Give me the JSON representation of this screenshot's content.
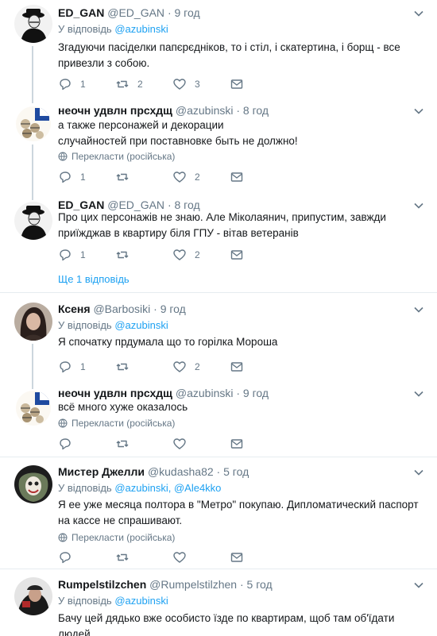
{
  "reply_label": "У відповідь",
  "translate_label": "Перекласти (російська)",
  "more_replies": "Ще 1 відповідь",
  "tweets": [
    {
      "name": "ED_GAN",
      "handle": "@ED_GAN",
      "dot": "·",
      "time": "9 год",
      "reply_to": "@azubinski",
      "text": "Згадуючи пасіделки папєрєдніков, то і стіл, і скатертина, і борщ - все привезли з собою.",
      "replies": "1",
      "retweets": "2",
      "likes": "3"
    },
    {
      "name": "неочн удвлн прсхдщ",
      "handle": "@azubinski",
      "dot": "·",
      "time": "8 год",
      "text": "а также персонажей и декорации\nслучайностей при поставновке быть не должно!",
      "replies": "1",
      "retweets": "",
      "likes": "2"
    },
    {
      "name": "ED_GAN",
      "handle": "@ED_GAN",
      "dot": "·",
      "time": "8 год",
      "text": "Про цих персонажів не знаю. Але Міколаянич, припустим, завжди приїжджав в квартиру біля ГПУ - вітав ветеранів",
      "replies": "1",
      "retweets": "",
      "likes": "2"
    },
    {
      "name": "Ксеня",
      "handle": "@Barbosiki",
      "dot": "·",
      "time": "9 год",
      "reply_to": "@azubinski",
      "text": "Я спочатку прдумала що то горілка Мороша",
      "replies": "1",
      "retweets": "",
      "likes": "2"
    },
    {
      "name": "неочн удвлн прсхдщ",
      "handle": "@azubinski",
      "dot": "·",
      "time": "9 год",
      "text": "всё много хуже оказалось"
    },
    {
      "name": "Мистер Джелли",
      "handle": "@kudasha82",
      "dot": "·",
      "time": "5 год",
      "reply_to": "@azubinski",
      "reply_sep": ", ",
      "reply_to2": "@Ale4kko",
      "text": "Я ее уже месяца полтора в \"Метро\" покупаю. Дипломатический паспорт на кассе не спрашивают."
    },
    {
      "name": "Rumpelstilzchen",
      "handle": "@Rumpelstilzhen",
      "dot": "·",
      "time": "5 год",
      "reply_to": "@azubinski",
      "text": "Бачу цей дядько вже особисто їзде по квартирам, щоб там об'їдати людей."
    }
  ],
  "colors": {
    "accent": "#1da1f2",
    "muted": "#657786",
    "text": "#14171a",
    "border": "#e6ecf0"
  }
}
